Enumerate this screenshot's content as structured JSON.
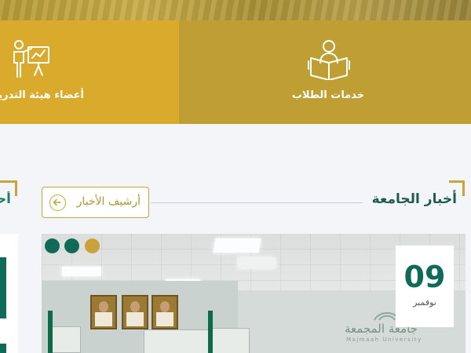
{
  "services": {
    "faculty_label": "أعضاء هيئة التدريس",
    "students_label": "خدمات الطلاب",
    "faculty_icon": "teacher-board-icon",
    "students_icon": "student-reading-icon"
  },
  "news": {
    "title": "أخبار الجامعة",
    "left_title": "أحداث",
    "archive_label": "أرشيف الأخبار",
    "archive_icon": "arrow-left-circle-icon",
    "date_day": "09",
    "date_month": "نوفمبر",
    "photo_logo_text": "جامعة المجمعة",
    "photo_logo_sub": "Majmaah University"
  },
  "colors": {
    "gold_primary": "#d9aa2b",
    "gold_secondary": "#bf9f33",
    "green_primary": "#0f6b58",
    "dot_active": "#c9a23a",
    "dot_inactive": "#0f6b58"
  }
}
